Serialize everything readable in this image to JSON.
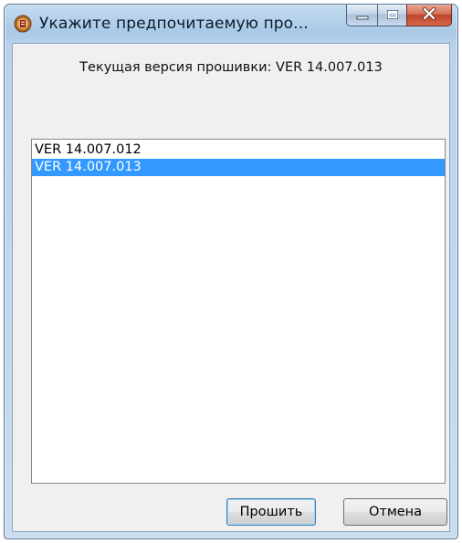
{
  "window": {
    "title": "Укажите предпочитаемую про...",
    "icon": "firmware-app-icon",
    "caption_buttons": [
      "minimize-icon",
      "maximize-icon",
      "close-icon"
    ]
  },
  "current_version_label": "Текущая версия прошивки: VER 14.007.013",
  "versions": {
    "items": [
      "VER 14.007.012",
      "VER 14.007.013"
    ],
    "selected_index": 1
  },
  "buttons": {
    "flash_label": "Прошить",
    "cancel_label": "Отмена"
  },
  "colors": {
    "selection": "#3399ff",
    "close_button": "#c0432a",
    "default_button_border": "#3c7fb1"
  }
}
